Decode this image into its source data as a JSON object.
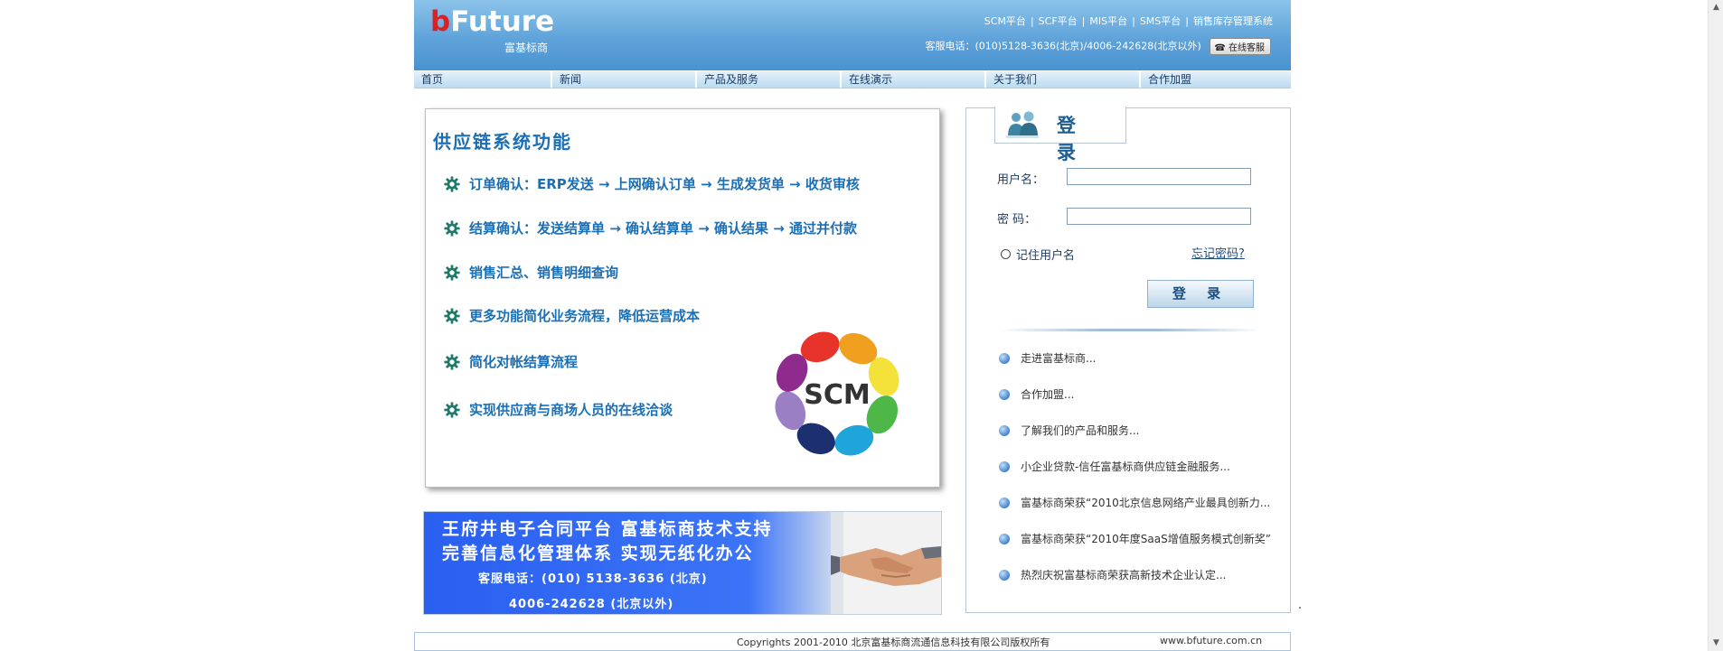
{
  "header": {
    "logo_b": "b",
    "logo_rest": "Future",
    "logo_sub": "富基标商",
    "top_links": [
      "SCM平台",
      "SCF平台",
      "MIS平台",
      "SMS平台",
      "销售库存管理系统"
    ],
    "service_text": "客服电话：(010)5128-3636(北京)/4006-242628(北京以外)",
    "service_button": "在线客服"
  },
  "nav": [
    "首页",
    "新闻",
    "产品及服务",
    "在线演示",
    "关于我们",
    "合作加盟"
  ],
  "features": {
    "title": "供应链系统功能",
    "items": [
      "订单确认：ERP发送 → 上网确认订单 → 生成发货单 → 收货审核",
      "结算确认：发送结算单 → 确认结算单 → 确认结果 → 通过并付款",
      "销售汇总、销售明细查询",
      "更多功能简化业务流程，降低运营成本",
      "简化对帐结算流程",
      "实现供应商与商场人员的在线洽谈"
    ],
    "logo_text": "SCM"
  },
  "banner": {
    "line1": "王府井电子合同平台  富基标商技术支持",
    "line2": "完善信息化管理体系  实现无纸化办公",
    "line3": "客服电话：(010) 5138-3636 (北京)",
    "line4": "4006-242628 (北京以外)"
  },
  "login": {
    "title": "登 录",
    "username_label": "用户名：",
    "password_label": "密  码：",
    "username_value": "",
    "password_value": "",
    "remember_label": "记住用户名",
    "forgot_label": "忘记密码?",
    "submit_label": "登 录"
  },
  "news": [
    "走进富基标商...",
    "合作加盟...",
    "了解我们的产品和服务...",
    "小企业贷款-信任富基标商供应链金融服务...",
    "富基标商荣获“2010北京信息网络产业最具创新力...",
    "富基标商荣获“2010年度SaaS增值服务模式创新奖”",
    "热烈庆祝富基标商荣获高新技术企业认定..."
  ],
  "footer": {
    "copyright": "Copyrights 2001-2010 北京富基标商流通信息科技有限公司版权所有",
    "site": "www.bfuture.com.cn"
  },
  "colors": {
    "header_blue": "#5fa3da",
    "feature_blue": "#1b6fb6",
    "banner_blue": "#2a5ff0",
    "gear_green": "#1f7a6a"
  }
}
